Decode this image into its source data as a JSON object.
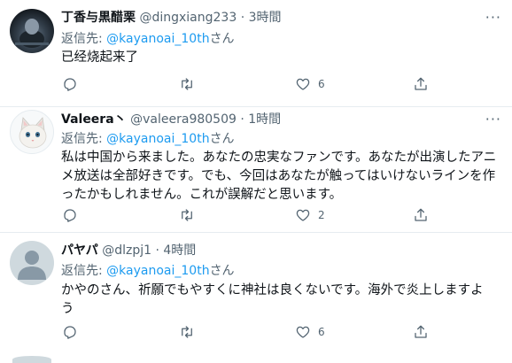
{
  "reply_prefix": "返信先: ",
  "tweets": [
    {
      "name": "丁香与黒醋栗",
      "handle": "@dingxiang233",
      "time": "3時間",
      "reply_to": "@kayanoai_10th",
      "reply_suffix": "さん",
      "text": "已经烧起来了",
      "likes": "6",
      "avatar": "dark-photo"
    },
    {
      "name": "Valeera丶",
      "handle": "@valeera980509",
      "time": "1時間",
      "reply_to": "@kayanoai_10th",
      "reply_suffix": "さん",
      "text": "私は中国から来ました。あなたの忠実なファンです。あなたが出演したアニメ放送は全部好きです。でも、今回はあなたが触ってはいけないラインを作ったかもしれません。これが誤解だと思います。",
      "likes": "2",
      "avatar": "white-cat"
    },
    {
      "name": "パヤパ",
      "handle": "@dlzpj1",
      "time": "4時間",
      "reply_to": "@kayanoai_10th",
      "reply_suffix": "さん",
      "text": "かやのさん、祈願でもやすくに神社は良くないです。海外で炎上しますよう",
      "likes": "6",
      "avatar": "default-silhouette"
    }
  ],
  "icons": {
    "reply": "reply-icon",
    "retweet": "retweet-icon",
    "like": "heart-icon",
    "share": "share-icon",
    "more": "more-icon"
  },
  "colors": {
    "link": "#1d9bf0",
    "secondary_text": "#536471",
    "divider": "#e6ecf0"
  }
}
